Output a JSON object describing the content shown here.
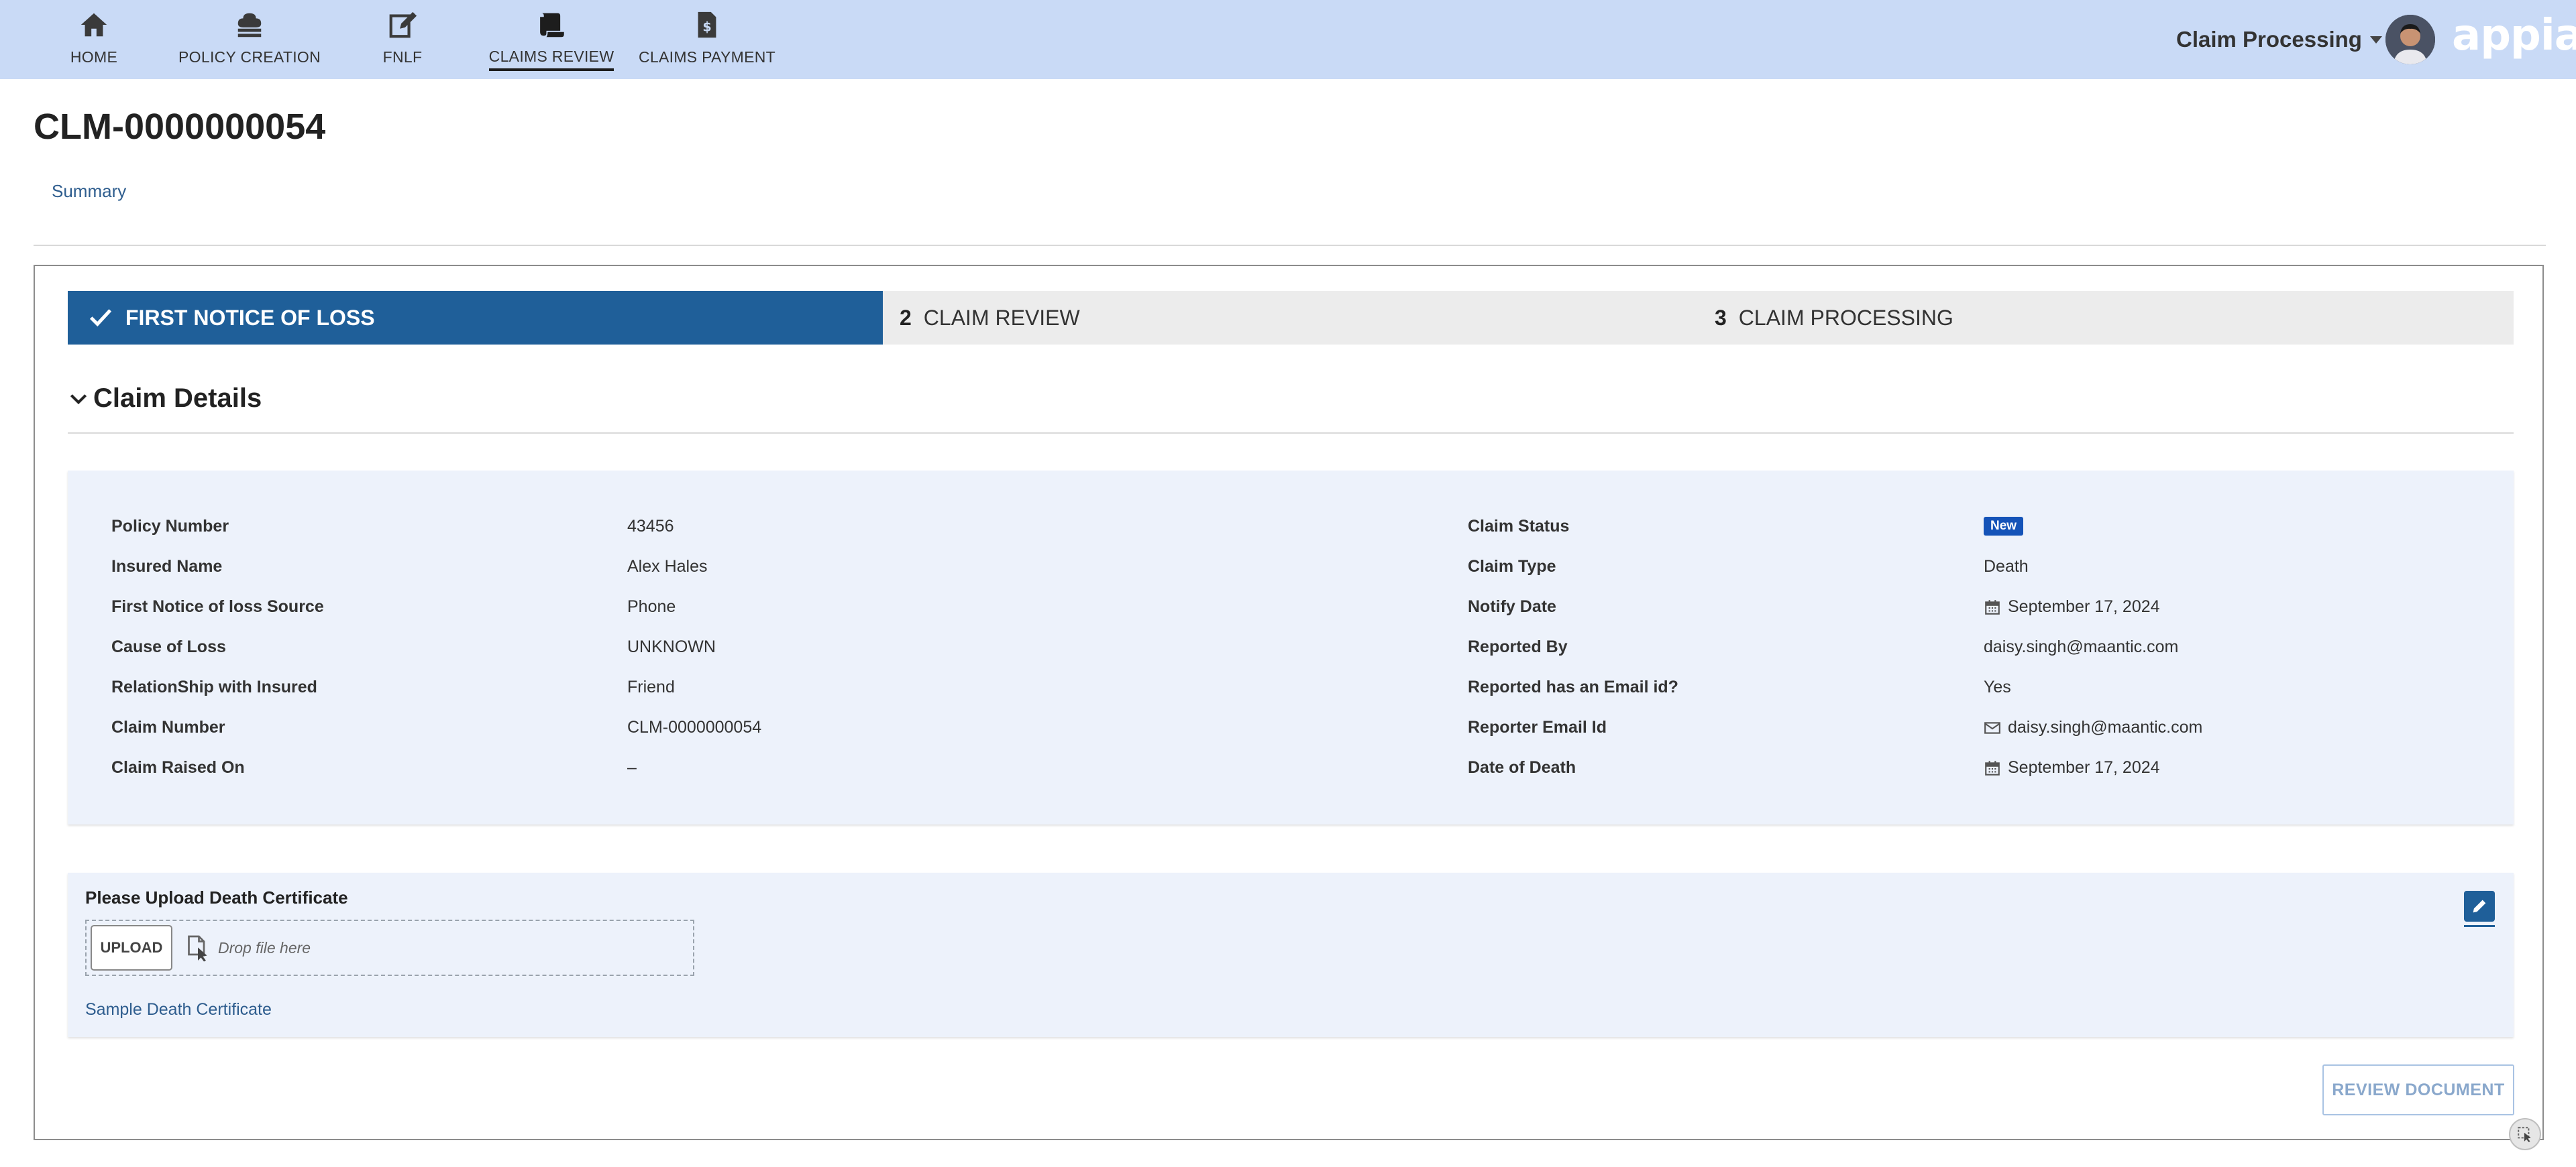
{
  "nav": {
    "items": [
      {
        "label": "HOME",
        "icon": "home-icon"
      },
      {
        "label": "POLICY CREATION",
        "icon": "policy-icon"
      },
      {
        "label": "FNLF",
        "icon": "edit-form-icon"
      },
      {
        "label": "CLAIMS REVIEW",
        "icon": "scroll-icon",
        "active": true
      },
      {
        "label": "CLAIMS PAYMENT",
        "icon": "payment-doc-icon"
      }
    ],
    "app_switch_label": "Claim Processing",
    "logo_text": "appian"
  },
  "page": {
    "title": "CLM-0000000054",
    "summary_link": "Summary"
  },
  "stepper": {
    "steps": [
      {
        "number": "",
        "label": "FIRST NOTICE OF LOSS",
        "state": "complete"
      },
      {
        "number": "2",
        "label": "CLAIM REVIEW",
        "state": "pending"
      },
      {
        "number": "3",
        "label": "CLAIM PROCESSING",
        "state": "pending"
      }
    ]
  },
  "claim_details": {
    "section_title": "Claim Details",
    "left": [
      {
        "label": "Policy Number",
        "value": "43456"
      },
      {
        "label": "Insured Name",
        "value": "Alex Hales"
      },
      {
        "label": "First Notice of loss Source",
        "value": "Phone"
      },
      {
        "label": "Cause of Loss",
        "value": "UNKNOWN"
      },
      {
        "label": "RelationShip with Insured",
        "value": "Friend"
      },
      {
        "label": "Claim Number",
        "value": "CLM-0000000054"
      },
      {
        "label": "Claim Raised On",
        "value": "–"
      }
    ],
    "right": [
      {
        "label": "Claim Status",
        "value": "New"
      },
      {
        "label": "Claim Type",
        "value": "Death"
      },
      {
        "label": "Notify Date",
        "value": "September 17, 2024"
      },
      {
        "label": "Reported By",
        "value": "daisy.singh@maantic.com"
      },
      {
        "label": "Reported has an Email id?",
        "value": "Yes"
      },
      {
        "label": "Reporter Email Id",
        "value": "daisy.singh@maantic.com"
      },
      {
        "label": "Date of Death",
        "value": "September 17, 2024"
      }
    ]
  },
  "upload": {
    "label": "Please Upload Death Certificate",
    "button_label": "UPLOAD",
    "drop_hint": "Drop file here",
    "sample_link": "Sample Death Certificate"
  },
  "actions": {
    "review_document": "REVIEW DOCUMENT"
  },
  "colors": {
    "topbar": "#c9daf6",
    "step_active": "#1f5f99",
    "badge_new": "#1453b8",
    "link": "#2e5d8e",
    "panel": "#edf2fb"
  }
}
